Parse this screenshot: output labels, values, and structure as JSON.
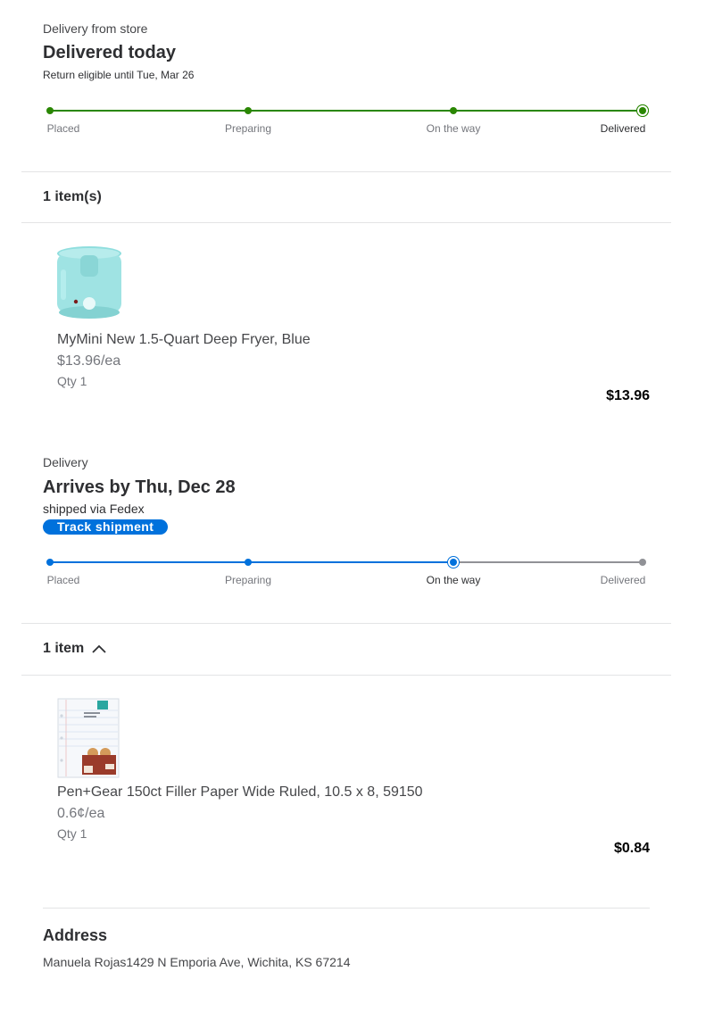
{
  "shipment1": {
    "kicker": "Delivery from store",
    "headline": "Delivered today",
    "subline": "Return eligible until Tue, Mar 26",
    "steps": [
      "Placed",
      "Preparing",
      "On the way",
      "Delivered"
    ],
    "current_step": "Delivered",
    "accent": "#2a8703",
    "item_count_label": "1 item(s)",
    "item": {
      "name": "MyMini New 1.5-Quart Deep Fryer, Blue",
      "unit_price": "$13.96/ea",
      "qty": "Qty 1",
      "total": "$13.96",
      "image_icon": "deep-fryer-image"
    }
  },
  "shipment2": {
    "kicker": "Delivery",
    "headline": "Arrives by Thu, Dec 28",
    "subline": "shipped via Fedex",
    "track_button": "Track shipment",
    "steps": [
      "Placed",
      "Preparing",
      "On the way",
      "Delivered"
    ],
    "current_step": "On the way",
    "accent": "#0071dc",
    "pending_color": "#909196",
    "item_count_label": "1 item",
    "toggle_icon": "chevron-up-icon",
    "item": {
      "name": "Pen+Gear 150ct Filler Paper Wide Ruled, 10.5 x 8, 59150",
      "unit_price": "0.6¢/ea",
      "qty": "Qty 1",
      "total": "$0.84",
      "image_icon": "filler-paper-image"
    }
  },
  "address": {
    "title": "Address",
    "text": "Manuela Rojas1429 N Emporia Ave, Wichita, KS 67214"
  }
}
